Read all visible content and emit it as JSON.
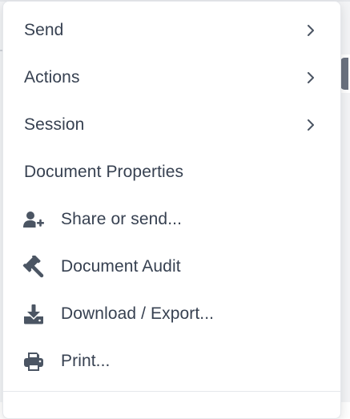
{
  "menu": {
    "items": [
      {
        "label": "Send",
        "submenu": true
      },
      {
        "label": "Actions",
        "submenu": true
      },
      {
        "label": "Session",
        "submenu": true
      },
      {
        "label": "Document Properties",
        "submenu": false
      },
      {
        "label": "Share or send...",
        "icon": "user-plus-icon"
      },
      {
        "label": "Document Audit",
        "icon": "gavel-icon"
      },
      {
        "label": "Download / Export...",
        "icon": "download-icon"
      },
      {
        "label": "Print...",
        "icon": "printer-icon"
      }
    ]
  },
  "colors": {
    "text": "#374151",
    "icon": "#4b5563",
    "border": "#e5e7eb"
  }
}
